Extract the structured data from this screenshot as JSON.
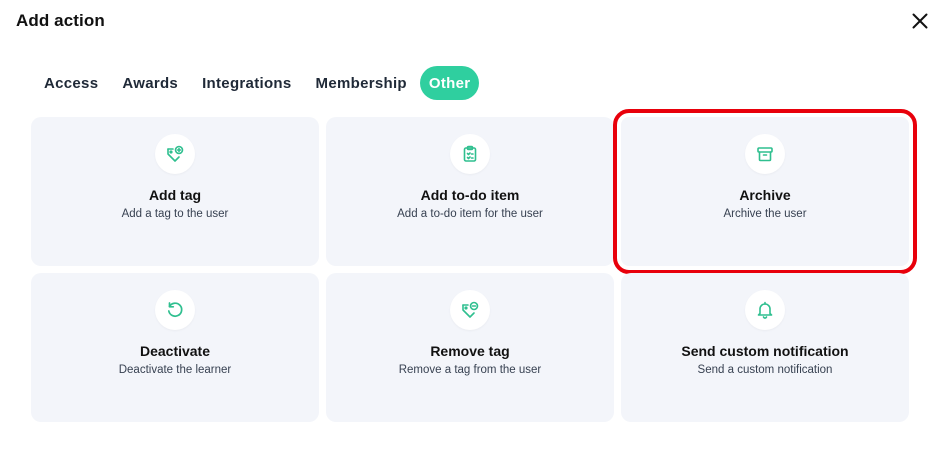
{
  "dialog": {
    "title": "Add action"
  },
  "tabs": [
    {
      "label": "Access"
    },
    {
      "label": "Awards"
    },
    {
      "label": "Integrations"
    },
    {
      "label": "Membership"
    },
    {
      "label": "Other",
      "active": true
    }
  ],
  "cards": [
    {
      "title": "Add tag",
      "description": "Add a tag to the user",
      "icon": "tag-plus-icon"
    },
    {
      "title": "Add to-do item",
      "description": "Add a to-do item for the user",
      "icon": "clipboard-list-icon"
    },
    {
      "title": "Archive",
      "description": "Archive the user",
      "icon": "archive-box-icon",
      "highlighted": true
    },
    {
      "title": "Deactivate",
      "description": "Deactivate the learner",
      "icon": "rotate-ccw-icon"
    },
    {
      "title": "Remove tag",
      "description": "Remove a tag from the user",
      "icon": "tag-minus-icon"
    },
    {
      "title": "Send custom notification",
      "description": "Send a custom notification",
      "icon": "bell-icon"
    }
  ],
  "colors": {
    "accent": "#2fcf9f",
    "icon": "#2fbf8f",
    "card_bg": "#f3f5fa",
    "highlight": "#e8000b"
  }
}
